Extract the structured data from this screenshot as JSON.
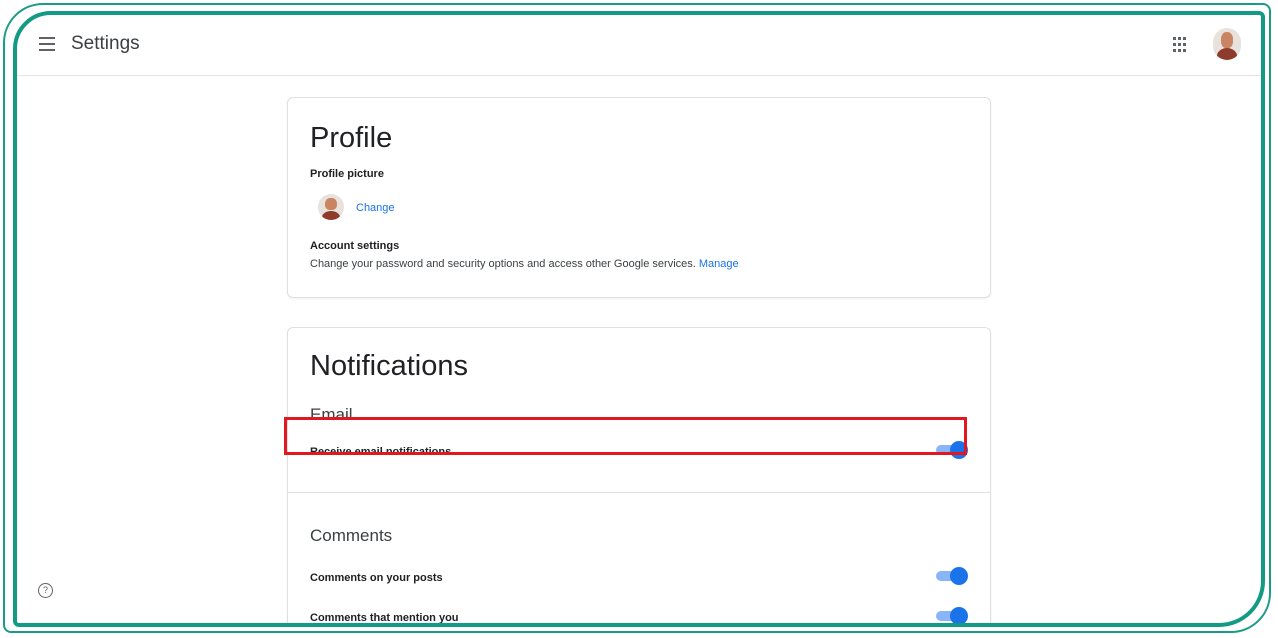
{
  "header": {
    "title": "Settings",
    "menu_icon": "hamburger-menu-icon",
    "apps_icon": "apps-grid-icon",
    "avatar_icon": "account-avatar"
  },
  "profile": {
    "title": "Profile",
    "picture_label": "Profile picture",
    "change_label": "Change",
    "account_label": "Account settings",
    "account_description": "Change your password and security options and access other Google services.",
    "manage_label": "Manage"
  },
  "notifications": {
    "title": "Notifications",
    "email": {
      "title": "Email",
      "items": [
        {
          "label": "Receive email notifications",
          "enabled": true
        }
      ]
    },
    "comments": {
      "title": "Comments",
      "items": [
        {
          "label": "Comments on your posts",
          "enabled": true
        },
        {
          "label": "Comments that mention you",
          "enabled": true
        }
      ]
    }
  },
  "help_icon": "help-circle-icon",
  "colors": {
    "accent": "#1a73e8",
    "toggle_track": "#8ab4f8",
    "highlight_border": "#e3171f",
    "frame": "#129a85"
  }
}
